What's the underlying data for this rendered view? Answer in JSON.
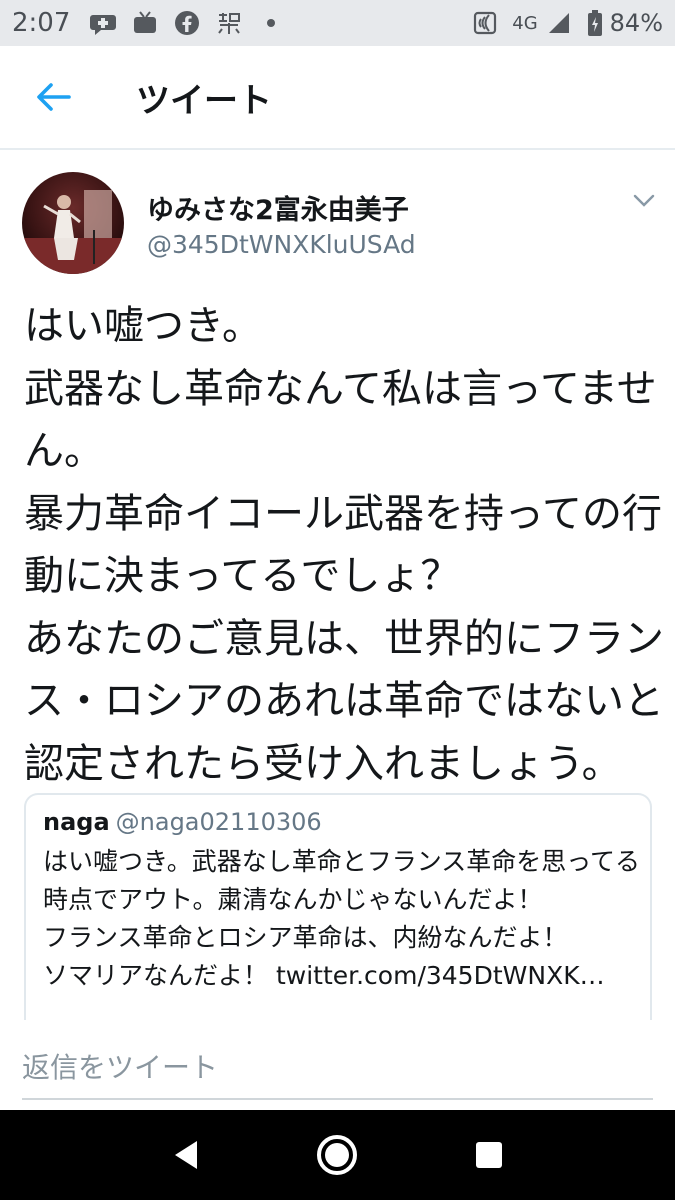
{
  "status_bar": {
    "time": "2:07",
    "network": "4G",
    "battery": "84%",
    "icons": [
      "chat-bubble-icon",
      "tv-icon",
      "facebook-icon",
      "kanji-notification-icon",
      "dot-icon",
      "nfc-icon",
      "signal-icon",
      "battery-icon"
    ]
  },
  "header": {
    "title": "ツイート",
    "back_icon": "arrow-left-icon"
  },
  "tweet": {
    "display_name": "ゆみさな2富永由美子",
    "handle": "@345DtWNXKluUSAd",
    "text": "はい嘘つき。\n武器なし革命なんて私は言ってません。\n暴力革命イコール武器を持っての行動に決まってるでしょ？\nあなたのご意見は、世界的にフランス・ロシアのあれは革命ではないと認定されたら受け入れましょう。"
  },
  "quote": {
    "name": "naga",
    "handle": "@naga02110306",
    "text": "はい嘘つき。武器なし革命とフランス革命を思ってる時点でアウト。粛清なんかじゃないんだよ！\nフランス革命とロシア革命は、内紛なんだよ！\nソマリアなんだよ！ twitter.com/345DtWNXK…"
  },
  "reply": {
    "placeholder": "返信をツイート"
  },
  "colors": {
    "accent": "#1da1f2",
    "text": "#14171a",
    "secondary": "#657786",
    "status_bar_bg": "#e7e9ec",
    "nav_bar_bg": "#000000"
  }
}
